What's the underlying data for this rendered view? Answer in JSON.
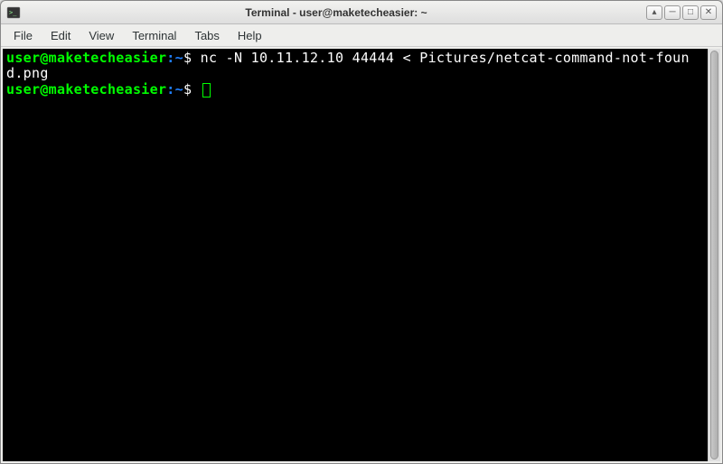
{
  "window": {
    "title": "Terminal - user@maketecheasier: ~"
  },
  "menubar": {
    "items": [
      "File",
      "Edit",
      "View",
      "Terminal",
      "Tabs",
      "Help"
    ]
  },
  "terminal": {
    "lines": [
      {
        "user": "user@maketecheasier",
        "sep": ":",
        "path": "~",
        "dollar": "$ ",
        "command": "nc -N 10.11.12.10 44444 < Pictures/netcat-command-not-found.png"
      },
      {
        "user": "user@maketecheasier",
        "sep": ":",
        "path": "~",
        "dollar": "$ ",
        "command": ""
      }
    ]
  },
  "controls": {
    "stick": "▴",
    "min": "─",
    "max": "□",
    "close": "✕"
  }
}
